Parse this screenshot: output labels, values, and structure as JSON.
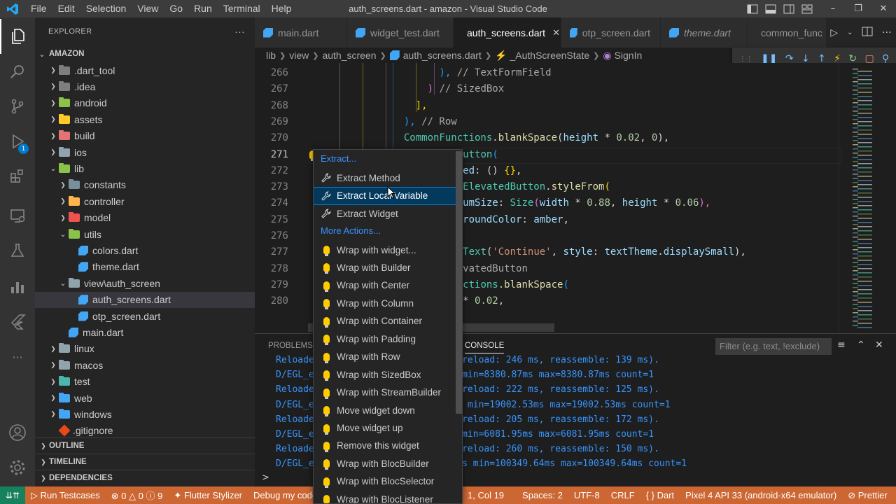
{
  "window": {
    "title": "auth_screens.dart - amazon - Visual Studio Code",
    "menu": [
      "File",
      "Edit",
      "Selection",
      "View",
      "Go",
      "Run",
      "Terminal",
      "Help"
    ]
  },
  "activity_bar": {
    "items": [
      "explorer-icon",
      "search-icon",
      "source-control-icon",
      "run-debug-icon",
      "extensions-icon",
      "remote-explorer-icon",
      "testing-icon",
      "chart-icon",
      "flutter-icon",
      "more-icon"
    ],
    "debug_badge": "1",
    "bottom": [
      "account-icon",
      "settings-gear-icon"
    ]
  },
  "sidebar": {
    "header": "EXPLORER",
    "more": "···",
    "project": "AMAZON",
    "tree": [
      {
        "label": ".dart_tool",
        "kind": "folder",
        "depth": 1,
        "open": false,
        "color": "#7e7e7e"
      },
      {
        "label": ".idea",
        "kind": "folder",
        "depth": 1,
        "open": false,
        "color": "#7e7e7e"
      },
      {
        "label": "android",
        "kind": "folder",
        "depth": 1,
        "open": false,
        "color": "#8bc34a"
      },
      {
        "label": "assets",
        "kind": "folder",
        "depth": 1,
        "open": false,
        "color": "#ffca28"
      },
      {
        "label": "build",
        "kind": "folder",
        "depth": 1,
        "open": false,
        "color": "#e57373"
      },
      {
        "label": "ios",
        "kind": "folder",
        "depth": 1,
        "open": false,
        "color": "#90a4ae"
      },
      {
        "label": "lib",
        "kind": "folder",
        "depth": 1,
        "open": true,
        "color": "#8bc34a"
      },
      {
        "label": "constants",
        "kind": "folder",
        "depth": 2,
        "open": false,
        "color": "#78909c"
      },
      {
        "label": "controller",
        "kind": "folder",
        "depth": 2,
        "open": false,
        "color": "#ffb74d"
      },
      {
        "label": "model",
        "kind": "folder",
        "depth": 2,
        "open": false,
        "color": "#ef5350"
      },
      {
        "label": "utils",
        "kind": "folder",
        "depth": 2,
        "open": true,
        "color": "#8bc34a"
      },
      {
        "label": "colors.dart",
        "kind": "dart",
        "depth": 3
      },
      {
        "label": "theme.dart",
        "kind": "dart",
        "depth": 3
      },
      {
        "label": "view\\auth_screen",
        "kind": "folder",
        "depth": 2,
        "open": true,
        "color": "#90a4ae"
      },
      {
        "label": "auth_screens.dart",
        "kind": "dart",
        "depth": 3,
        "selected": true
      },
      {
        "label": "otp_screen.dart",
        "kind": "dart",
        "depth": 3
      },
      {
        "label": "main.dart",
        "kind": "dart",
        "depth": 2
      },
      {
        "label": "linux",
        "kind": "folder",
        "depth": 1,
        "open": false,
        "color": "#90a4ae"
      },
      {
        "label": "macos",
        "kind": "folder",
        "depth": 1,
        "open": false,
        "color": "#90a4ae"
      },
      {
        "label": "test",
        "kind": "folder",
        "depth": 1,
        "open": false,
        "color": "#4db6ac"
      },
      {
        "label": "web",
        "kind": "folder",
        "depth": 1,
        "open": false,
        "color": "#42a5f5"
      },
      {
        "label": "windows",
        "kind": "folder",
        "depth": 1,
        "open": false,
        "color": "#42a5f5"
      },
      {
        "label": ".gitignore",
        "kind": "git",
        "depth": 1
      }
    ],
    "sections": [
      "OUTLINE",
      "TIMELINE",
      "DEPENDENCIES"
    ]
  },
  "tabs": [
    {
      "label": "main.dart",
      "active": false,
      "italic": false
    },
    {
      "label": "widget_test.dart",
      "active": false,
      "italic": false
    },
    {
      "label": "auth_screens.dart",
      "active": true,
      "italic": false
    },
    {
      "label": "otp_screen.dart",
      "active": false,
      "italic": false
    },
    {
      "label": "theme.dart",
      "active": false,
      "italic": true
    },
    {
      "label": "common_func",
      "active": false,
      "italic": false
    }
  ],
  "breadcrumb": [
    "lib",
    "view",
    "auth_screen",
    "auth_screens.dart",
    "_AuthScreenState",
    "SignIn"
  ],
  "editor": {
    "line_numbers": [
      "266",
      "267",
      "268",
      "269",
      "270",
      "271",
      "272",
      "273",
      "274",
      "275",
      "276",
      "277",
      "278",
      "279",
      "280"
    ],
    "current_line": "271",
    "lines": [
      [
        {
          "t": "                      "
        },
        {
          "t": "),",
          "c": "br3"
        },
        {
          "t": " // TextFormField",
          "c": "cm"
        }
      ],
      [
        {
          "t": "                    "
        },
        {
          "t": ")",
          "c": "br2"
        },
        {
          "t": " // SizedBox",
          "c": "cm"
        }
      ],
      [
        {
          "t": "                  "
        },
        {
          "t": "],",
          "c": "br1"
        }
      ],
      [
        {
          "t": "                "
        },
        {
          "t": "),",
          "c": "br3"
        },
        {
          "t": " // Row",
          "c": "cm"
        }
      ],
      [
        {
          "t": "                "
        },
        {
          "t": "CommonFunctions",
          "c": "cls"
        },
        {
          "t": "."
        },
        {
          "t": "blankSpace",
          "c": "fn"
        },
        {
          "t": "("
        },
        {
          "t": "height",
          "c": "var"
        },
        {
          "t": " * "
        },
        {
          "t": "0.02",
          "c": "num"
        },
        {
          "t": ", "
        },
        {
          "t": "0",
          "c": "num"
        },
        {
          "t": "),"
        }
      ],
      [
        {
          "t": "                          "
        },
        {
          "t": "utton",
          "c": "cls"
        },
        {
          "t": "(",
          "c": "br3"
        }
      ],
      [
        {
          "t": "                          "
        },
        {
          "t": "ed",
          "c": "var"
        },
        {
          "t": ": () "
        },
        {
          "t": "{}",
          "c": "br1"
        },
        {
          "t": ","
        }
      ],
      [
        {
          "t": "                          "
        },
        {
          "t": "ElevatedButton",
          "c": "cls"
        },
        {
          "t": "."
        },
        {
          "t": "styleFrom",
          "c": "fn"
        },
        {
          "t": "(",
          "c": "br1"
        }
      ],
      [
        {
          "t": "                          "
        },
        {
          "t": "umSize",
          "c": "var"
        },
        {
          "t": ": "
        },
        {
          "t": "Size",
          "c": "cls"
        },
        {
          "t": "(",
          "c": "br2"
        },
        {
          "t": "width",
          "c": "var"
        },
        {
          "t": " * "
        },
        {
          "t": "0.88",
          "c": "num"
        },
        {
          "t": ", "
        },
        {
          "t": "height",
          "c": "var"
        },
        {
          "t": " * "
        },
        {
          "t": "0.06",
          "c": "num"
        },
        {
          "t": "),",
          "c": "br2"
        }
      ],
      [
        {
          "t": "                          "
        },
        {
          "t": "roundColor",
          "c": "var"
        },
        {
          "t": ": "
        },
        {
          "t": "amber",
          "c": "var"
        },
        {
          "t": ","
        }
      ],
      [
        {
          "t": ""
        }
      ],
      [
        {
          "t": "                          "
        },
        {
          "t": "Text",
          "c": "cls"
        },
        {
          "t": "("
        },
        {
          "t": "'Continue'",
          "c": "str"
        },
        {
          "t": ", "
        },
        {
          "t": "style",
          "c": "var"
        },
        {
          "t": ": "
        },
        {
          "t": "textTheme",
          "c": "var"
        },
        {
          "t": "."
        },
        {
          "t": "displaySmall",
          "c": "var"
        },
        {
          "t": "),"
        }
      ],
      [
        {
          "t": "                          "
        },
        {
          "t": "vatedButton",
          "c": "cm"
        }
      ],
      [
        {
          "t": "                          "
        },
        {
          "t": "ctions",
          "c": "cls"
        },
        {
          "t": "."
        },
        {
          "t": "blankSpace",
          "c": "fn"
        },
        {
          "t": "(",
          "c": "br3"
        }
      ],
      [
        {
          "t": "                          "
        },
        {
          "t": "* "
        },
        {
          "t": "0.02",
          "c": "num"
        },
        {
          "t": ","
        }
      ]
    ]
  },
  "quick_fix": {
    "extract_header": "Extract...",
    "extract_items": [
      "Extract Method",
      "Extract Local Variable",
      "Extract Widget"
    ],
    "selected": "Extract Local Variable",
    "more_header": "More Actions...",
    "wrap_items": [
      "Wrap with widget...",
      "Wrap with Builder",
      "Wrap with Center",
      "Wrap with Column",
      "Wrap with Container",
      "Wrap with Padding",
      "Wrap with Row",
      "Wrap with SizedBox",
      "Wrap with StreamBuilder",
      "Move widget down",
      "Move widget up",
      "Remove this widget",
      "Wrap with BlocBuilder",
      "Wrap with BlocSelector",
      "Wrap with BlocListener"
    ]
  },
  "panel": {
    "tabs": [
      "PROBLEMS",
      "CONSOLE"
    ],
    "active_tab": "CONSOLE",
    "filter_placeholder": "Filter (e.g. text, !exclude)",
    "console_lines": [
      "Reloade        s (compile: 32 ms, reload: 246 ms, reassemble: 139 ms).",
      "D/EGL_e        ats: avg=8380.87ms min=8380.87ms max=8380.87ms count=1",
      "Reloade        s (compile: 55 ms, reload: 222 ms, reassemble: 125 ms).",
      "D/EGL_e        ats: avg=19002.53ms min=19002.53ms max=19002.53ms count=1",
      "Reloade        s (compile: 45 ms, reload: 205 ms, reassemble: 172 ms).",
      "D/EGL_e        ats: avg=6081.95ms min=6081.95ms max=6081.95ms count=1",
      "Reloade        s (compile: 61 ms, reload: 260 ms, reassemble: 150 ms).",
      "D/EGL_e        ats: avg=100349.64ms min=100349.64ms max=100349.64ms count=1"
    ],
    "prompt": ">"
  },
  "status_bar": {
    "run_testcases": "Run Testcases",
    "errors": "0",
    "warnings": "0",
    "infos": "9",
    "flutter_stylizer": "Flutter Stylizer",
    "debug": "Debug my code",
    "cursor": "1, Col 19",
    "spaces": "Spaces: 2",
    "encoding": "UTF-8",
    "eol": "CRLF",
    "language": "Dart",
    "device": "Pixel 4 API 33 (android-x64 emulator)",
    "prettier": "Prettier"
  },
  "colors": {
    "status_bar": "#cc6633",
    "remote": "#16825d",
    "accent": "#007acc",
    "link": "#3794ff"
  }
}
